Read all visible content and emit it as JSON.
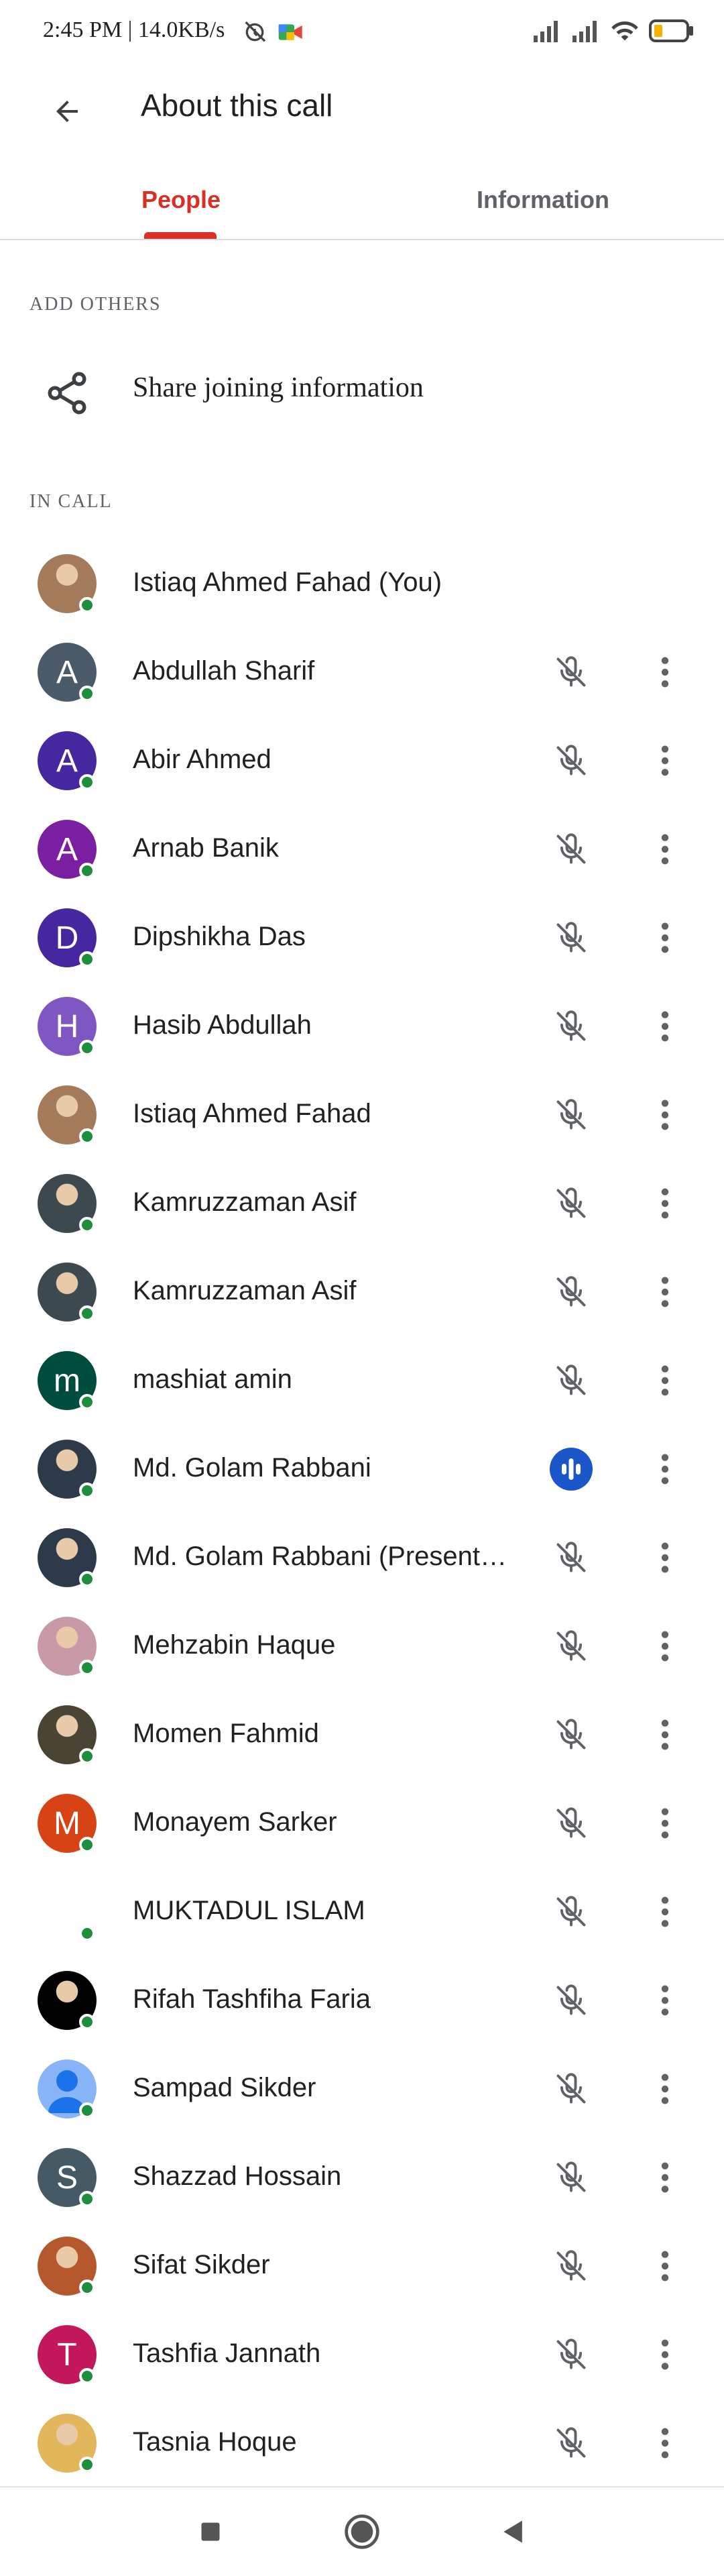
{
  "status_bar": {
    "time_speed": "2:45 PM | 14.0KB/s",
    "icons": [
      "alarm-off-icon",
      "meet-app-icon",
      "signal-icon",
      "signal-icon",
      "wifi-icon",
      "battery-low-icon"
    ]
  },
  "app_bar": {
    "title": "About this call",
    "back_icon": "arrow-back-icon"
  },
  "tabs": [
    {
      "label": "People",
      "selected": true
    },
    {
      "label": "Information",
      "selected": false
    }
  ],
  "sections": {
    "add_others": "ADD OTHERS",
    "in_call": "IN CALL"
  },
  "share": {
    "label": "Share joining information",
    "icon": "share-icon"
  },
  "colors": {
    "accent": "#d93025",
    "online": "#1e8e3e",
    "speaking": "#1a56c9"
  },
  "participants": [
    {
      "name": "Istiaq Ahmed Fahad (You)",
      "avatar": "photo",
      "letter": "",
      "color": "#a37a5a",
      "mic": "none"
    },
    {
      "name": "Abdullah Sharif",
      "avatar": "letter",
      "letter": "A",
      "color": "#4a5a68",
      "mic": "muted"
    },
    {
      "name": "Abir Ahmed",
      "avatar": "letter",
      "letter": "A",
      "color": "#4527a0",
      "mic": "muted"
    },
    {
      "name": "Arnab Banik",
      "avatar": "letter",
      "letter": "A",
      "color": "#7b1fa2",
      "mic": "muted"
    },
    {
      "name": "Dipshikha Das",
      "avatar": "letter",
      "letter": "D",
      "color": "#4527a0",
      "mic": "muted"
    },
    {
      "name": "Hasib Abdullah",
      "avatar": "letter",
      "letter": "H",
      "color": "#7e57c2",
      "mic": "muted"
    },
    {
      "name": "Istiaq Ahmed Fahad",
      "avatar": "photo",
      "letter": "",
      "color": "#a37a5a",
      "mic": "muted"
    },
    {
      "name": "Kamruzzaman Asif",
      "avatar": "photo",
      "letter": "",
      "color": "#3c4a4f",
      "mic": "muted"
    },
    {
      "name": "Kamruzzaman Asif",
      "avatar": "photo",
      "letter": "",
      "color": "#3c4a4f",
      "mic": "muted"
    },
    {
      "name": "mashiat amin",
      "avatar": "letter",
      "letter": "m",
      "color": "#004d40",
      "mic": "muted"
    },
    {
      "name": "Md. Golam Rabbani",
      "avatar": "photo",
      "letter": "",
      "color": "#2d3a4a",
      "mic": "speaking"
    },
    {
      "name": "Md. Golam Rabbani (Present…",
      "avatar": "photo",
      "letter": "",
      "color": "#2d3a4a",
      "mic": "muted"
    },
    {
      "name": "Mehzabin Haque",
      "avatar": "photo",
      "letter": "",
      "color": "#c79aa5",
      "mic": "muted"
    },
    {
      "name": "Momen Fahmid",
      "avatar": "photo",
      "letter": "",
      "color": "#4a4434",
      "mic": "muted"
    },
    {
      "name": "Monayem Sarker",
      "avatar": "letter",
      "letter": "M",
      "color": "#d84315",
      "mic": "muted"
    },
    {
      "name": "MUKTADUL ISLAM",
      "avatar": "blank",
      "letter": "",
      "color": "#ffffff",
      "mic": "muted"
    },
    {
      "name": "Rifah Tashfiha Faria",
      "avatar": "photo",
      "letter": "",
      "color": "#000000",
      "mic": "muted"
    },
    {
      "name": "Sampad Sikder",
      "avatar": "default",
      "letter": "",
      "color": "#8ab4f8",
      "mic": "muted"
    },
    {
      "name": "Shazzad Hossain",
      "avatar": "letter",
      "letter": "S",
      "color": "#455a64",
      "mic": "muted"
    },
    {
      "name": "Sifat Sikder",
      "avatar": "photo",
      "letter": "",
      "color": "#b5582e",
      "mic": "muted"
    },
    {
      "name": "Tashfia Jannath",
      "avatar": "letter",
      "letter": "T",
      "color": "#c2185b",
      "mic": "muted"
    },
    {
      "name": "Tasnia Hoque",
      "avatar": "photo",
      "letter": "",
      "color": "#e2b65a",
      "mic": "muted"
    }
  ],
  "nav_bar": {
    "icons": [
      "recents-square-icon",
      "home-circle-icon",
      "back-triangle-icon"
    ]
  }
}
